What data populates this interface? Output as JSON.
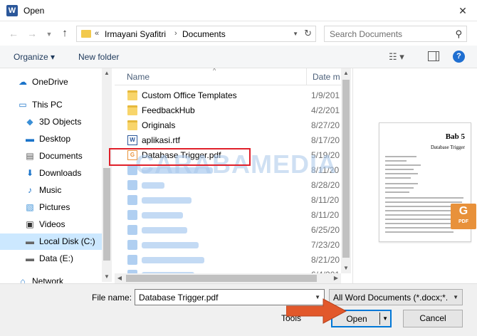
{
  "window": {
    "title": "Open",
    "app_icon": "W",
    "close_glyph": "✕"
  },
  "address": {
    "crumbs": [
      "Irmayani Syafitri",
      "Documents"
    ],
    "overflow": "«",
    "separator": "›",
    "search_placeholder": "Search Documents"
  },
  "toolbar": {
    "organize_label": "Organize ▾",
    "new_folder_label": "New folder",
    "help": "?"
  },
  "sidebar": {
    "items": [
      {
        "label": "OneDrive",
        "icon": "cloud-icon"
      },
      {
        "label": "This PC",
        "icon": "computer-icon"
      },
      {
        "label": "3D Objects",
        "icon": "cube-icon"
      },
      {
        "label": "Desktop",
        "icon": "desktop-icon"
      },
      {
        "label": "Documents",
        "icon": "documents-icon"
      },
      {
        "label": "Downloads",
        "icon": "download-icon"
      },
      {
        "label": "Music",
        "icon": "music-icon"
      },
      {
        "label": "Pictures",
        "icon": "pictures-icon"
      },
      {
        "label": "Videos",
        "icon": "video-icon"
      },
      {
        "label": "Local Disk (C:)",
        "icon": "drive-icon",
        "selected": true
      },
      {
        "label": "Data (E:)",
        "icon": "drive-icon"
      },
      {
        "label": "Network",
        "icon": "network-icon"
      }
    ]
  },
  "columns": {
    "name": "Name",
    "date": "Date m"
  },
  "files": [
    {
      "name": "Custom Office Templates",
      "date": "1/9/201",
      "type": "folder"
    },
    {
      "name": "FeedbackHub",
      "date": "4/2/201",
      "type": "folder"
    },
    {
      "name": "Originals",
      "date": "8/27/20",
      "type": "folder"
    },
    {
      "name": "aplikasi.rtf",
      "date": "8/17/20",
      "type": "doc"
    },
    {
      "name": "Database Trigger.pdf",
      "date": "5/19/20",
      "type": "pdf",
      "selected": true
    },
    {
      "name": "",
      "date": "8/11/20",
      "type": "blurred"
    },
    {
      "name": "",
      "date": "8/28/20",
      "type": "blurred"
    },
    {
      "name": "",
      "date": "8/11/20",
      "type": "blurred"
    },
    {
      "name": "",
      "date": "8/11/20",
      "type": "blurred"
    },
    {
      "name": "",
      "date": "6/25/20",
      "type": "blurred"
    },
    {
      "name": "",
      "date": "7/23/20",
      "type": "blurred"
    },
    {
      "name": "",
      "date": "8/21/20",
      "type": "blurred"
    },
    {
      "name": "",
      "date": "6/4/201",
      "type": "blurred"
    }
  ],
  "watermark": "CARABAMEDIA",
  "preview": {
    "heading": "Bab 5",
    "subheading": "Database Trigger",
    "badge_text": "PDF"
  },
  "footer": {
    "file_name_label": "File name:",
    "file_name_value": "Database Trigger.pdf",
    "file_type_value": "All Word Documents (*.docx;*.d",
    "tools_label": "Tools",
    "open_label": "Open",
    "cancel_label": "Cancel"
  },
  "colors": {
    "accent": "#0078d7",
    "highlight": "#e0202a",
    "arrow": "#e2582b",
    "pdf": "#e8913a"
  }
}
